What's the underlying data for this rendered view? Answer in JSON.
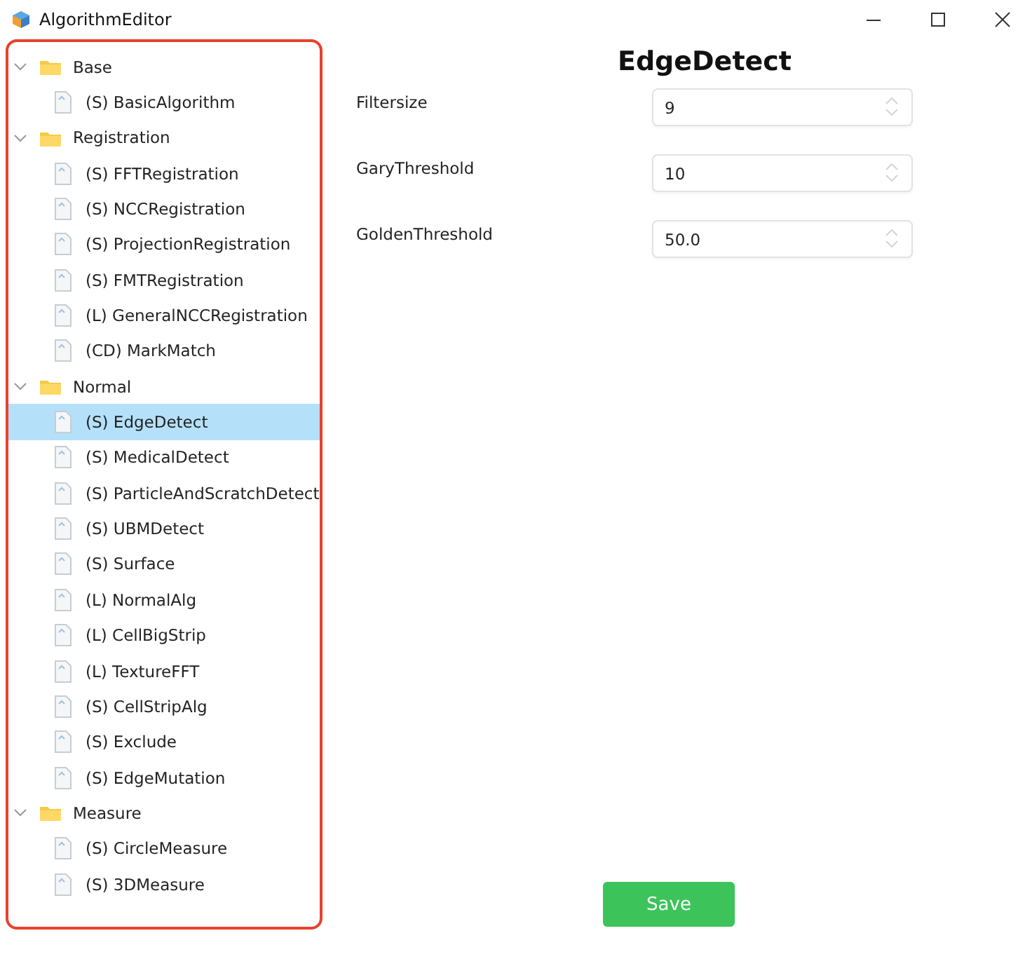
{
  "window": {
    "title": "AlgorithmEditor"
  },
  "tree": [
    {
      "label": "Base",
      "expanded": true,
      "children": [
        {
          "label": "(S) BasicAlgorithm",
          "selected": false
        }
      ]
    },
    {
      "label": "Registration",
      "expanded": true,
      "children": [
        {
          "label": "(S) FFTRegistration",
          "selected": false
        },
        {
          "label": "(S) NCCRegistration",
          "selected": false
        },
        {
          "label": "(S) ProjectionRegistration",
          "selected": false
        },
        {
          "label": "(S) FMTRegistration",
          "selected": false
        },
        {
          "label": "(L) GeneralNCCRegistration",
          "selected": false
        },
        {
          "label": "(CD) MarkMatch",
          "selected": false
        }
      ]
    },
    {
      "label": "Normal",
      "expanded": true,
      "children": [
        {
          "label": "(S) EdgeDetect",
          "selected": true
        },
        {
          "label": "(S) MedicalDetect",
          "selected": false
        },
        {
          "label": "(S) ParticleAndScratchDetect",
          "selected": false
        },
        {
          "label": "(S) UBMDetect",
          "selected": false
        },
        {
          "label": "(S) Surface",
          "selected": false
        },
        {
          "label": "(L) NormalAlg",
          "selected": false
        },
        {
          "label": "(L) CellBigStrip",
          "selected": false
        },
        {
          "label": "(L) TextureFFT",
          "selected": false
        },
        {
          "label": "(S) CellStripAlg",
          "selected": false
        },
        {
          "label": "(S) Exclude",
          "selected": false
        },
        {
          "label": "(S) EdgeMutation",
          "selected": false
        }
      ]
    },
    {
      "label": "Measure",
      "expanded": true,
      "children": [
        {
          "label": "(S) CircleMeasure",
          "selected": false
        },
        {
          "label": "(S) 3DMeasure",
          "selected": false
        }
      ]
    }
  ],
  "editor": {
    "title": "EdgeDetect",
    "params": [
      {
        "label": "Filtersize",
        "value": "9"
      },
      {
        "label": "GaryThreshold",
        "value": "10"
      },
      {
        "label": "GoldenThreshold",
        "value": "50.0"
      }
    ],
    "save_button": "Save"
  }
}
